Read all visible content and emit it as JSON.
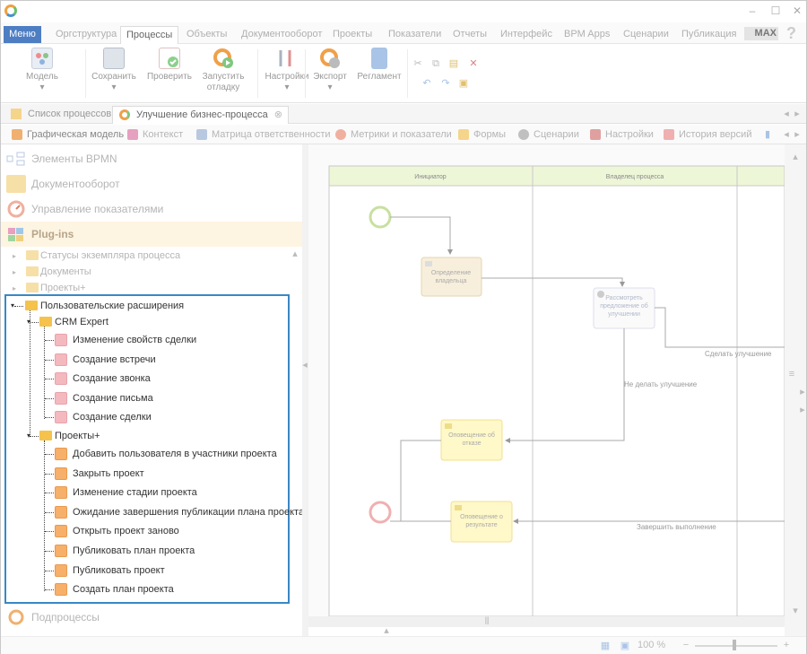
{
  "app": {
    "window_controls": [
      "–",
      "☐",
      "✕"
    ]
  },
  "menu": {
    "menu_button": "Меню",
    "tabs": [
      "Оргструктура",
      "Процессы",
      "Объекты",
      "Документооборот",
      "Проекты",
      "Показатели",
      "Отчеты",
      "Интерфейс",
      "BPM Apps",
      "Сценарии",
      "Публикация"
    ],
    "active_tab": "Процессы",
    "brand": "MAX",
    "help": "?"
  },
  "ribbon": {
    "buttons": [
      {
        "label": "Модель",
        "sub": "▾",
        "icon": "model-icon"
      },
      {
        "label": "Сохранить",
        "sub": "▾",
        "icon": "save-icon"
      },
      {
        "label": "Проверить",
        "sub": "",
        "icon": "check-icon"
      },
      {
        "label": "Запустить",
        "sub": "отладку",
        "icon": "debug-icon"
      },
      {
        "label": "Настройки",
        "sub": "▾",
        "icon": "settings-icon"
      },
      {
        "label": "Экспорт",
        "sub": "▾",
        "icon": "export-icon"
      },
      {
        "label": "Регламент",
        "sub": "",
        "icon": "reglament-icon"
      }
    ]
  },
  "doc_tabs": [
    {
      "label": "Список процессов"
    },
    {
      "label": "Улучшение бизнес-процесса",
      "close": "⊗"
    }
  ],
  "sub_tabs": [
    "Графическая модель",
    "Контекст",
    "Матрица ответственности",
    "Метрики и показатели",
    "Формы",
    "Сценарии",
    "Настройки",
    "История версий"
  ],
  "left": {
    "sections": {
      "bpmn": "Элементы BPMN",
      "docflow": "Документооборот",
      "kpi": "Управление показателями",
      "plugins": "Plug-ins",
      "subprocesses": "Подпроцессы"
    },
    "tree_faded": [
      "Статусы экземпляра процесса",
      "Документы",
      "Проекты+"
    ],
    "tree": {
      "root": "Пользовательские расширения",
      "crm": {
        "label": "CRM Expert",
        "items": [
          "Изменение свойств сделки",
          "Создание встречи",
          "Создание звонка",
          "Создание письма",
          "Создание сделки"
        ]
      },
      "projects": {
        "label": "Проекты+",
        "items": [
          "Добавить пользователя в участники проекта",
          "Закрыть проект",
          "Изменение стадии проекта",
          "Ожидание завершения публикации плана проекта",
          "Открыть проект заново",
          "Публиковать план проекта",
          "Публиковать проект",
          "Создать план проекта"
        ]
      }
    }
  },
  "diagram": {
    "lanes": [
      "Инициатор",
      "Владелец процесса"
    ],
    "tasks": [
      "Определение владельца",
      "Рассмотреть предложение об улучшении",
      "Оповещение об отказе",
      "Оповещение о результате"
    ],
    "flows": [
      "Сделать улучшение",
      "Не делать улучшение",
      "Завершить выполнение"
    ]
  },
  "status": {
    "zoom": "100 %",
    "minus": "−",
    "plus": "+"
  },
  "colors": {
    "accent": "#4d7ec3",
    "highlight": "#3a87c4",
    "crm_item": "#f3b9bf",
    "project_item": "#f7b06a",
    "folder": "#f5c24c"
  }
}
